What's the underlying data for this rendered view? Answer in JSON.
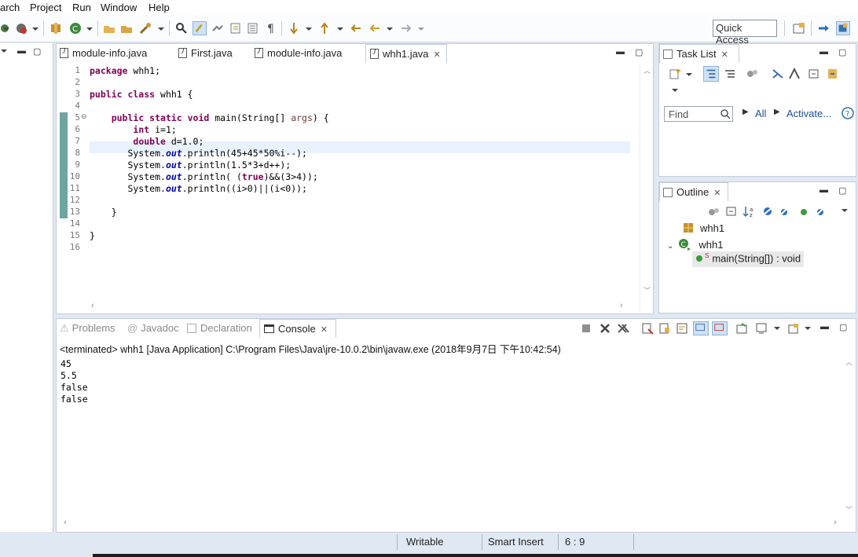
{
  "menu": [
    "arch",
    "Project",
    "Run",
    "Window",
    "Help"
  ],
  "toolbar": {
    "quick_access": "Quick Access"
  },
  "editor": {
    "tabs": [
      "module-info.java",
      "First.java",
      "module-info.java",
      "whh1.java"
    ],
    "active_tab": "whh1.java",
    "line_numbers": [
      "1",
      "2",
      "3",
      "4",
      "5",
      "6",
      "7",
      "8",
      "9",
      "10",
      "11",
      "12",
      "13",
      "14",
      "15",
      "16"
    ]
  },
  "tasklist": {
    "title": "Task List",
    "find_placeholder": "Find",
    "all_label": "All",
    "activate_label": "Activate..."
  },
  "outline": {
    "title": "Outline",
    "items": [
      "whh1",
      "whh1",
      "main(String[]) : void"
    ]
  },
  "console_panel": {
    "tabs": [
      "Problems",
      "Javadoc",
      "Declaration",
      "Console"
    ],
    "active_tab": "Console",
    "header": "<terminated> whh1 [Java Application] C:\\Program Files\\Java\\jre-10.0.2\\bin\\javaw.exe (2018年9月7日 下午10:42:54)",
    "output": [
      "45",
      "5.5",
      "false",
      "false"
    ]
  },
  "statusbar": {
    "writable": "Writable",
    "insert_mode": "Smart Insert",
    "position": "6 : 9"
  },
  "colors": {
    "keyword": "#7f0055",
    "field": "#0000c0",
    "link": "#1d4d94",
    "gutter": "#6ea5a0"
  }
}
